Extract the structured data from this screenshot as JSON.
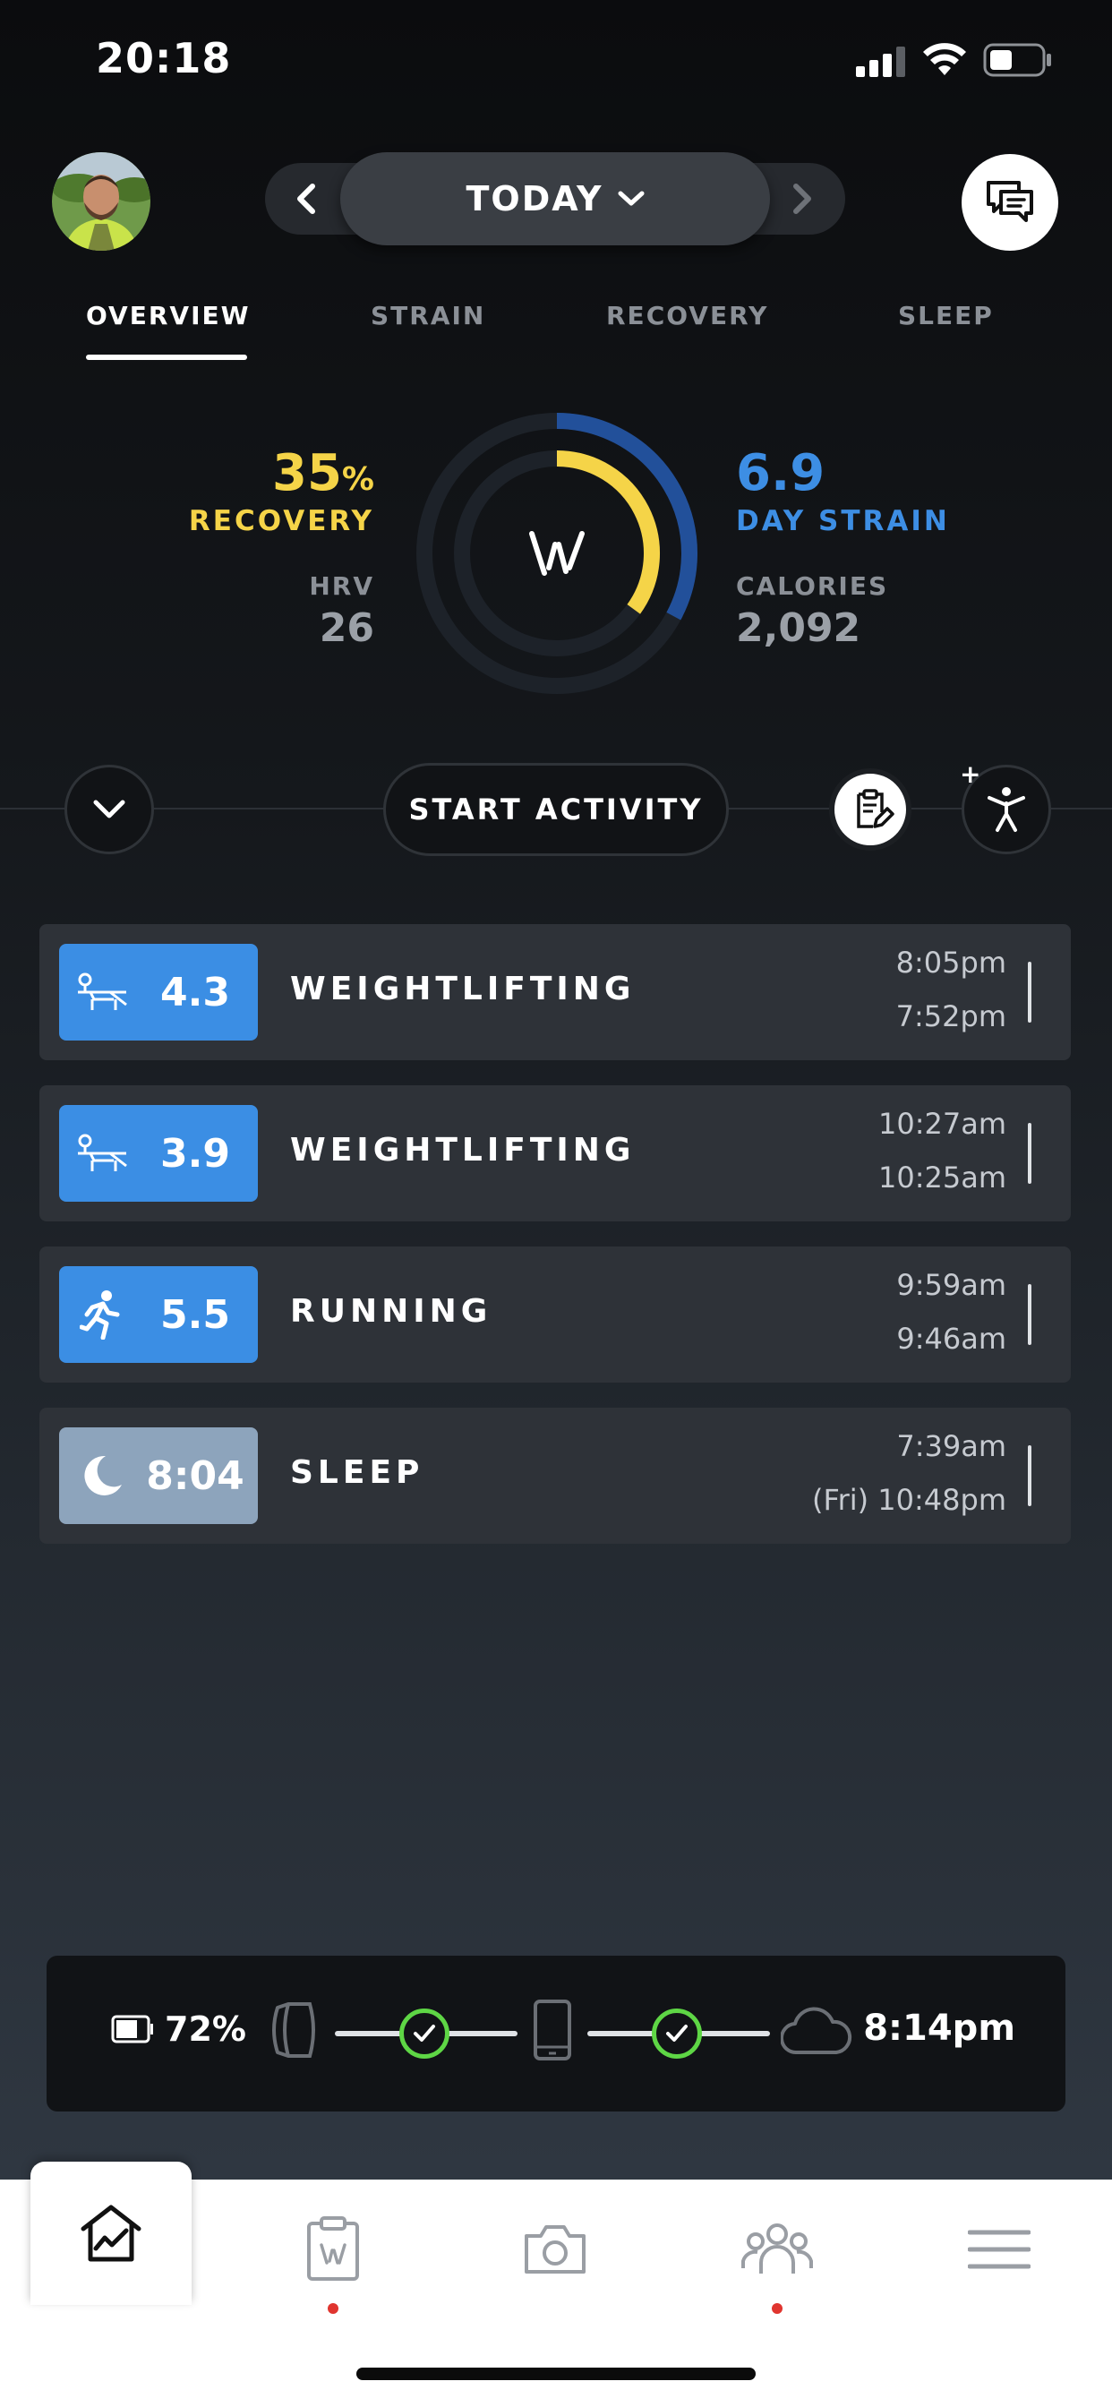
{
  "status_bar": {
    "time": "20:18"
  },
  "header": {
    "date_label": "TODAY"
  },
  "tabs": [
    {
      "label": "OVERVIEW",
      "active": true
    },
    {
      "label": "STRAIN"
    },
    {
      "label": "RECOVERY"
    },
    {
      "label": "SLEEP"
    }
  ],
  "overview": {
    "recovery_value": "35",
    "recovery_unit": "%",
    "recovery_label": "RECOVERY",
    "recovery_fraction": 0.35,
    "hrv_label": "HRV",
    "hrv_value": "26",
    "strain_value": "6.9",
    "strain_label": "DAY STRAIN",
    "strain_max": 21,
    "calories_label": "CALORIES",
    "calories_value": "2,092",
    "colors": {
      "recovery": "#f5d448",
      "strain": "#3d8ee4"
    }
  },
  "actions": {
    "start_activity_label": "START ACTIVITY",
    "plus_label": "+"
  },
  "activities": [
    {
      "type": "weightlifting",
      "icon": "weightlifting-icon",
      "value": "4.3",
      "title": "WEIGHTLIFTING",
      "end_time": "8:05pm",
      "start_time": "7:52pm"
    },
    {
      "type": "weightlifting",
      "icon": "weightlifting-icon",
      "value": "3.9",
      "title": "WEIGHTLIFTING",
      "end_time": "10:27am",
      "start_time": "10:25am"
    },
    {
      "type": "running",
      "icon": "running-icon",
      "value": "5.5",
      "title": "RUNNING",
      "end_time": "9:59am",
      "start_time": "9:46am"
    },
    {
      "type": "sleep",
      "icon": "moon-icon",
      "value": "8:04",
      "title": "SLEEP",
      "end_time": "7:39am",
      "start_time": "(Fri) 10:48pm"
    }
  ],
  "sync": {
    "battery_percent": "72%",
    "battery_level": 0.72,
    "last_sync": "8:14pm"
  },
  "bottom_nav": [
    "home-icon",
    "journal-icon",
    "camera-icon",
    "community-icon",
    "menu-icon"
  ]
}
